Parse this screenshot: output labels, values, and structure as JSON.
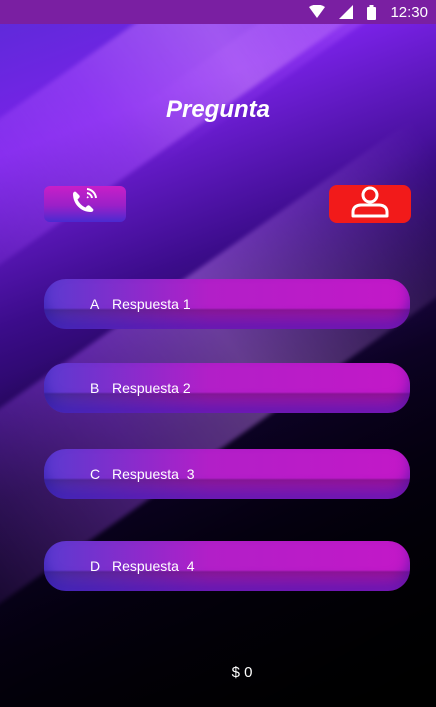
{
  "status_bar": {
    "time": "12:30"
  },
  "question": {
    "title": "Pregunta"
  },
  "lifelines": {
    "call_icon": "phone-call-icon",
    "audience_icon": "user-icon"
  },
  "answers": [
    {
      "letter": "A",
      "text": "Respuesta 1"
    },
    {
      "letter": "B",
      "text": "Respuesta 2"
    },
    {
      "letter": "C",
      "text": "Respuesta  3"
    },
    {
      "letter": "D",
      "text": "Respuesta  4"
    }
  ],
  "footer": {
    "money": "$ 0"
  },
  "colors": {
    "status_bar": "#7a1fa2",
    "user_button": "#f21a1a",
    "answer_accent": "#c318c8"
  }
}
